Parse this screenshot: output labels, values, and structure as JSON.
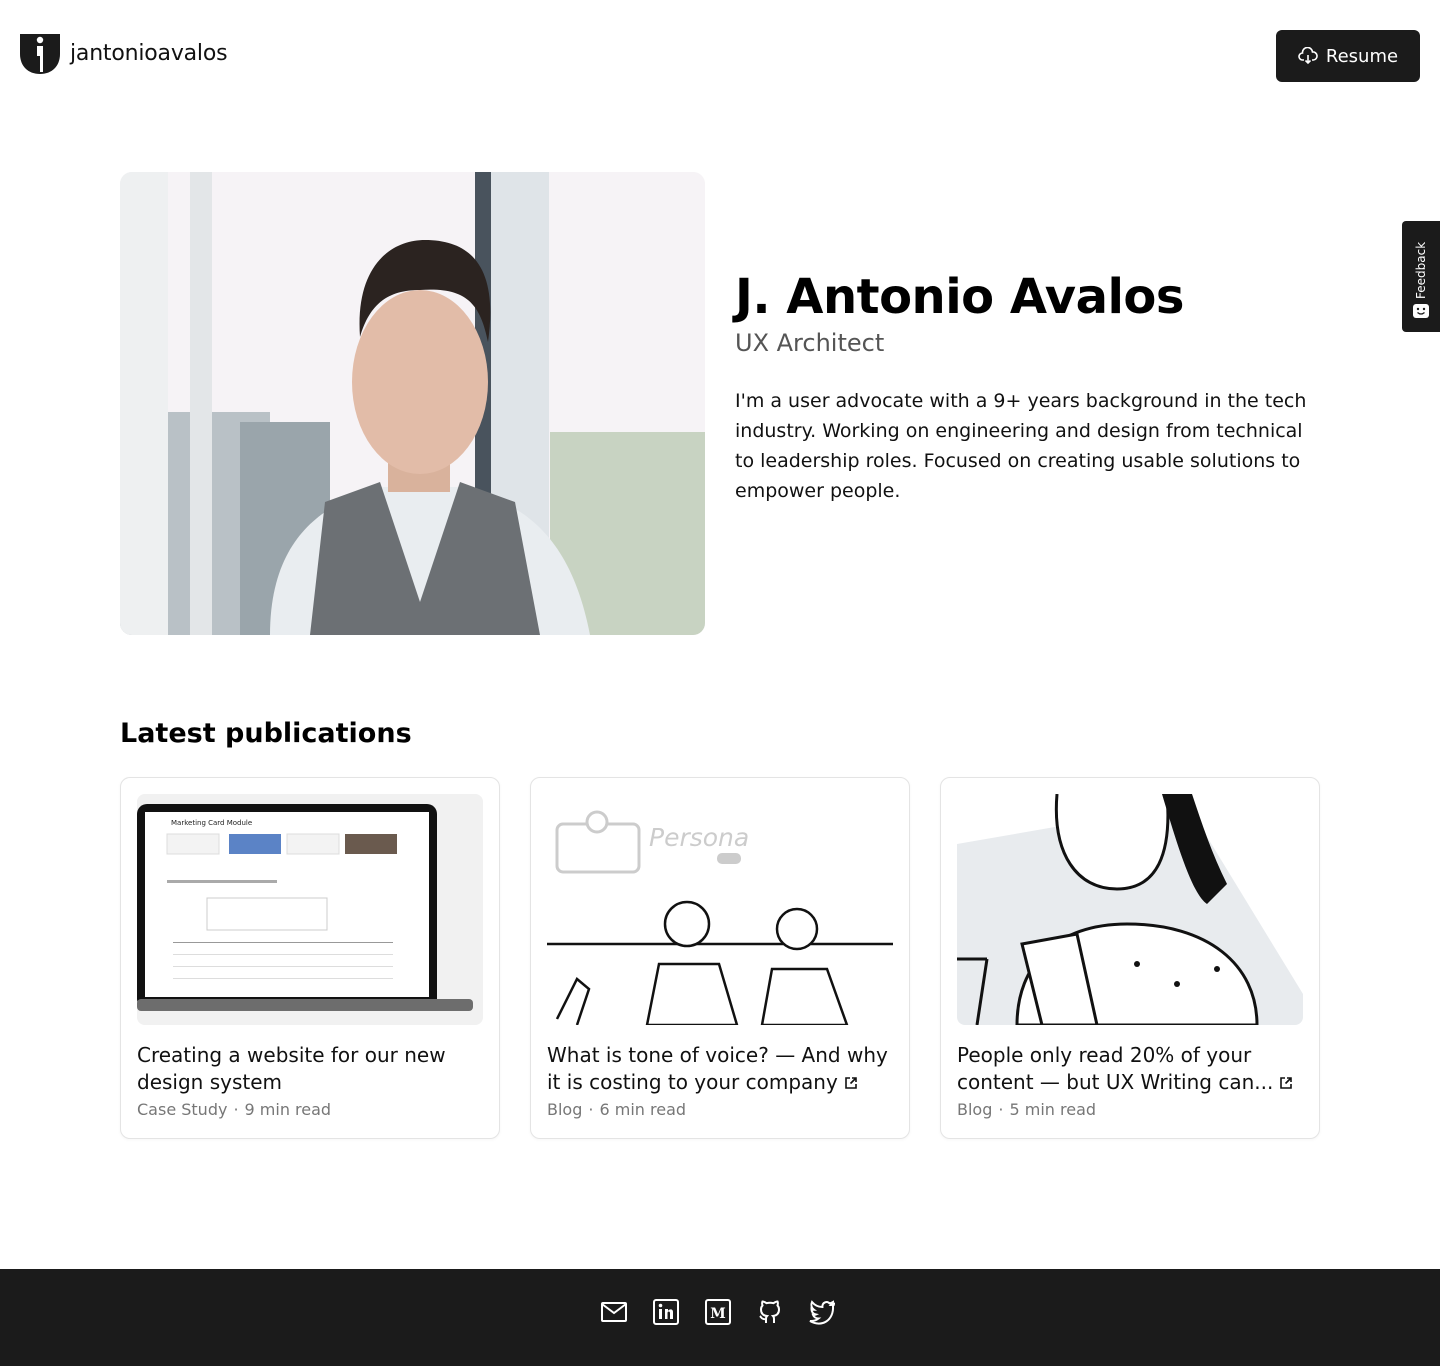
{
  "header": {
    "logo_text": "jantonioavalos",
    "resume_label": "Resume"
  },
  "feedback": {
    "label": "Feedback"
  },
  "hero": {
    "name": "J. Antonio Avalos",
    "role": "UX Architect",
    "bio": "I'm a user advocate with a 9+ years background in the tech industry. Working on engineering and design from technical to leadership roles. Focused on creating usable solutions to empower people."
  },
  "publications": {
    "title": "Latest publications",
    "items": [
      {
        "title": "Creating a website for our new design system",
        "type": "Case Study",
        "read": "9 min read",
        "external": false,
        "thumb_text": "Marketing Card Module"
      },
      {
        "title": "What is tone of voice? — And why it is costing to your company",
        "type": "Blog",
        "read": "6 min read",
        "external": true,
        "thumb_text": "Persona"
      },
      {
        "title": "People only read 20% of your content — but UX Writing can...",
        "type": "Blog",
        "read": "5 min read",
        "external": true,
        "thumb_text": ""
      }
    ]
  },
  "footer": {
    "icons": [
      "mail-icon",
      "linkedin-icon",
      "medium-icon",
      "github-icon",
      "twitter-icon"
    ]
  },
  "colors": {
    "dark": "#1b1b1b",
    "muted": "#777777"
  }
}
